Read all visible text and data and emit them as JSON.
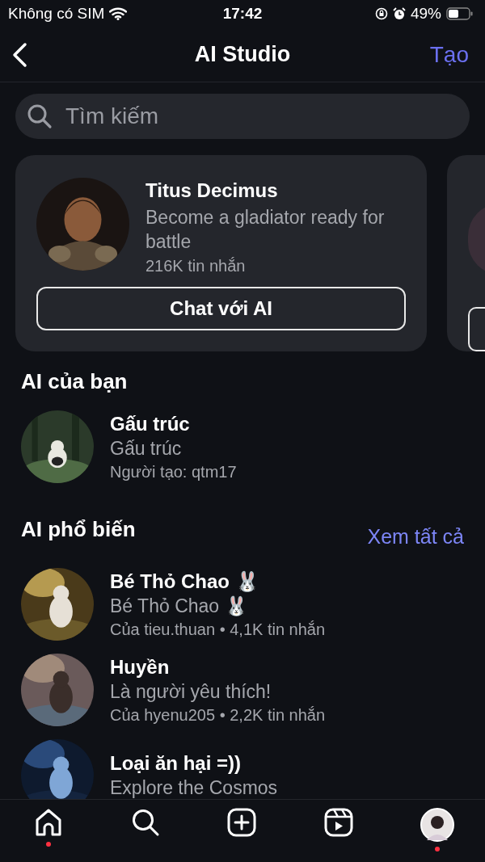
{
  "status_bar": {
    "carrier": "Không có SIM",
    "time": "17:42",
    "battery": "49%"
  },
  "nav": {
    "title": "AI Studio",
    "action": "Tạo"
  },
  "search": {
    "placeholder": "Tìm kiếm"
  },
  "featured": [
    {
      "name": "Titus Decimus",
      "description": "Become a gladiator ready for battle",
      "messages": "216K tin nhắn",
      "button": "Chat với AI"
    }
  ],
  "yours": {
    "title": "AI của bạn",
    "items": [
      {
        "name": "Gấu trúc",
        "subtitle": "Gấu trúc",
        "meta": "Người tạo: qtm17"
      }
    ]
  },
  "popular": {
    "title": "AI phổ biến",
    "see_all": "Xem tất cả",
    "items": [
      {
        "name": "Bé Thỏ Chao 🐰",
        "subtitle": "Bé Thỏ Chao 🐰",
        "meta": "Của tieu.thuan • 4,1K tin nhắn"
      },
      {
        "name": "Huyền",
        "subtitle": "Là người yêu thích!",
        "meta": "Của hyenu205 • 2,2K tin nhắn"
      },
      {
        "name": "Loại ăn hại =))",
        "subtitle": "Explore the Cosmos"
      }
    ]
  },
  "tab_bar": [
    {
      "kind": "home",
      "badge": true
    },
    {
      "kind": "search",
      "badge": false
    },
    {
      "kind": "create",
      "badge": false
    },
    {
      "kind": "reels",
      "badge": false
    },
    {
      "kind": "profile",
      "badge": true
    }
  ]
}
